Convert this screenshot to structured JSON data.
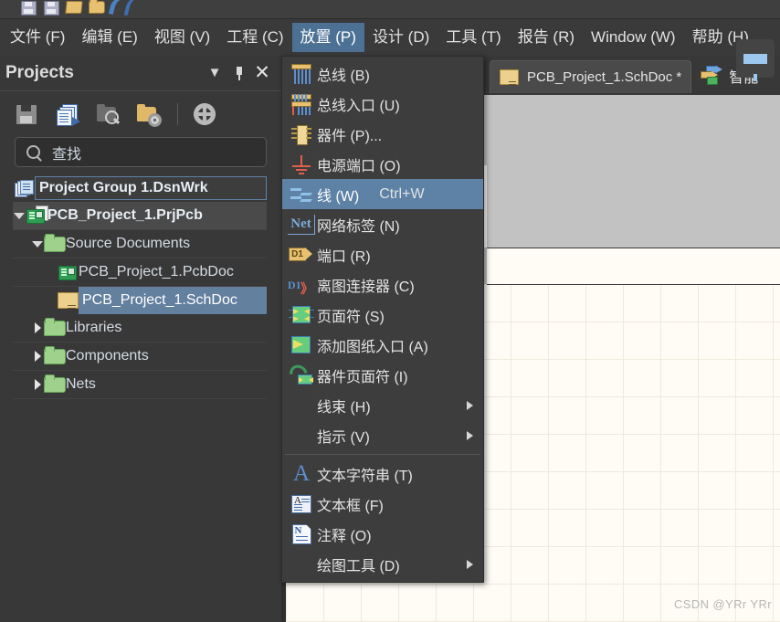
{
  "app": {
    "toolbar_icons": [
      "save-icon",
      "save-all-icon",
      "open-folder-icon",
      "open-folder-2-icon",
      "swoosh-logo-icon"
    ]
  },
  "menubar": {
    "items": [
      {
        "label": "文件 (F)",
        "name": "menu-file",
        "active": false
      },
      {
        "label": "编辑 (E)",
        "name": "menu-edit",
        "active": false
      },
      {
        "label": "视图 (V)",
        "name": "menu-view",
        "active": false
      },
      {
        "label": "工程 (C)",
        "name": "menu-project",
        "active": false
      },
      {
        "label": "放置 (P)",
        "name": "menu-place",
        "active": true
      },
      {
        "label": "设计 (D)",
        "name": "menu-design",
        "active": false
      },
      {
        "label": "工具 (T)",
        "name": "menu-tools",
        "active": false
      },
      {
        "label": "报告 (R)",
        "name": "menu-reports",
        "active": false
      },
      {
        "label": "Window (W)",
        "name": "menu-window",
        "active": false
      },
      {
        "label": "帮助 (H)",
        "name": "menu-help",
        "active": false
      }
    ]
  },
  "projects_panel": {
    "title": "Projects",
    "header_buttons": [
      "chevron-down-icon",
      "pin-icon",
      "close-icon"
    ],
    "toolbar_icons": [
      "save-icon",
      "copy-documents-icon",
      "folder-search-icon",
      "folder-settings-icon",
      "settings-gear-icon"
    ],
    "search": {
      "placeholder": "查找",
      "value": "查找",
      "icon": "search-icon"
    },
    "tree": [
      {
        "label": "Project Group 1.DsnWrk",
        "icon": "project-group-icon",
        "indent": 0,
        "twisty": "none",
        "state": "editing",
        "bold": true
      },
      {
        "label": "PCB_Project_1.PrjPcb",
        "icon": "pcb-project-icon",
        "indent": 0,
        "twisty": "down",
        "state": "focused",
        "bold": true
      },
      {
        "label": "Source Documents",
        "icon": "folder-icon",
        "indent": 1,
        "twisty": "down",
        "state": "normal",
        "bold": false
      },
      {
        "label": "PCB_Project_1.PcbDoc",
        "icon": "pcb-doc-icon",
        "indent": 2,
        "twisty": "none",
        "state": "normal",
        "bold": false
      },
      {
        "label": "PCB_Project_1.SchDoc",
        "icon": "sch-doc-icon",
        "indent": 2,
        "twisty": "none",
        "state": "selected",
        "bold": false
      },
      {
        "label": "Libraries",
        "icon": "folder-icon",
        "indent": 1,
        "twisty": "right",
        "state": "normal",
        "bold": false
      },
      {
        "label": "Components",
        "icon": "folder-icon",
        "indent": 1,
        "twisty": "right",
        "state": "normal",
        "bold": false
      },
      {
        "label": "Nets",
        "icon": "folder-icon",
        "indent": 1,
        "twisty": "right",
        "state": "normal",
        "bold": false
      }
    ]
  },
  "place_menu": {
    "items": [
      {
        "label": "总线 (B)",
        "icon": "bus-icon",
        "shortcut": "",
        "submenu": false,
        "selected": false,
        "separator_after": false
      },
      {
        "label": "总线入口 (U)",
        "icon": "bus-entry-icon",
        "shortcut": "",
        "submenu": false,
        "selected": false,
        "separator_after": false
      },
      {
        "label": "器件 (P)...",
        "icon": "component-icon",
        "shortcut": "",
        "submenu": false,
        "selected": false,
        "separator_after": false
      },
      {
        "label": "电源端口 (O)",
        "icon": "power-port-icon",
        "shortcut": "",
        "submenu": false,
        "selected": false,
        "separator_after": false
      },
      {
        "label": "线 (W)",
        "icon": "wire-icon",
        "shortcut": "Ctrl+W",
        "submenu": false,
        "selected": true,
        "separator_after": false
      },
      {
        "label": "网络标签 (N)",
        "icon": "net-label-icon",
        "shortcut": "",
        "submenu": false,
        "selected": false,
        "separator_after": false
      },
      {
        "label": "端口 (R)",
        "icon": "port-icon",
        "shortcut": "",
        "submenu": false,
        "selected": false,
        "separator_after": false
      },
      {
        "label": "离图连接器 (C)",
        "icon": "off-sheet-connector-icon",
        "shortcut": "",
        "submenu": false,
        "selected": false,
        "separator_after": false
      },
      {
        "label": "页面符 (S)",
        "icon": "sheet-symbol-icon",
        "shortcut": "",
        "submenu": false,
        "selected": false,
        "separator_after": false
      },
      {
        "label": "添加图纸入口 (A)",
        "icon": "sheet-entry-icon",
        "shortcut": "",
        "submenu": false,
        "selected": false,
        "separator_after": false
      },
      {
        "label": "器件页面符 (I)",
        "icon": "device-sheet-symbol-icon",
        "shortcut": "",
        "submenu": false,
        "selected": false,
        "separator_after": false
      },
      {
        "label": "线束 (H)",
        "icon": "none",
        "shortcut": "",
        "submenu": true,
        "selected": false,
        "separator_after": false
      },
      {
        "label": "指示 (V)",
        "icon": "none",
        "shortcut": "",
        "submenu": true,
        "selected": false,
        "separator_after": true
      },
      {
        "label": "文本字符串 (T)",
        "icon": "text-string-icon",
        "shortcut": "",
        "submenu": false,
        "selected": false,
        "separator_after": false
      },
      {
        "label": "文本框 (F)",
        "icon": "text-frame-icon",
        "shortcut": "",
        "submenu": false,
        "selected": false,
        "separator_after": false
      },
      {
        "label": "注释 (O)",
        "icon": "note-icon",
        "shortcut": "",
        "submenu": false,
        "selected": false,
        "separator_after": false
      },
      {
        "label": "绘图工具 (D)",
        "icon": "none",
        "shortcut": "",
        "submenu": true,
        "selected": false,
        "separator_after": false
      }
    ]
  },
  "document_area": {
    "tab": {
      "label": "PCB_Project_1.SchDoc *",
      "icon": "sch-doc-icon"
    },
    "extra_tab": {
      "label": "智能",
      "icon": "smart-connect-icon"
    },
    "float_button": {
      "icon": "funnel-filter-icon"
    }
  },
  "watermark": "CSDN @YRr YRr",
  "colors": {
    "menu_highlight": "#5d82a6",
    "panel_bg": "#383838",
    "menu_bg": "#3d3d3d",
    "tree_selected": "#63809f",
    "canvas_bg": "#fffcf6",
    "doc_bg": "#c2c2c2"
  }
}
